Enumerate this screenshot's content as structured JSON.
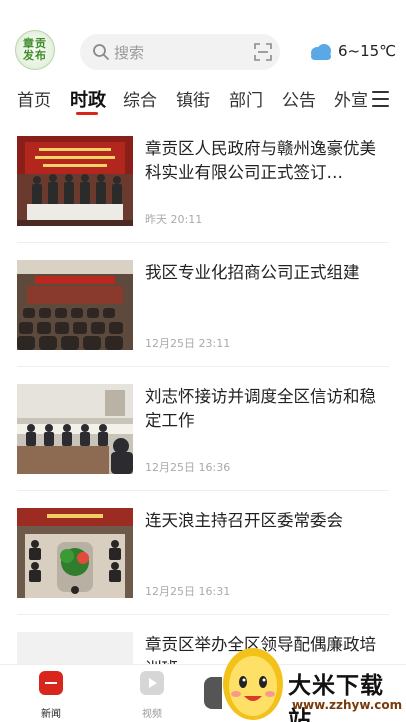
{
  "header": {
    "logo_text": [
      "章贡",
      "发布"
    ],
    "search": {
      "placeholder": "搜索"
    },
    "weather": {
      "temp": "6~15℃",
      "icon": "cloud-icon"
    }
  },
  "tabs": [
    {
      "label": "首页",
      "active": false
    },
    {
      "label": "时政",
      "active": true
    },
    {
      "label": "综合",
      "active": false
    },
    {
      "label": "镇街",
      "active": false
    },
    {
      "label": "部门",
      "active": false
    },
    {
      "label": "公告",
      "active": false
    },
    {
      "label": "外宣",
      "active": false
    }
  ],
  "news": [
    {
      "title": "章贡区人民政府与赣州逸豪优美科实业有限公司正式签订…",
      "time": "昨天 20:11",
      "thumb": "signing-ceremony-photo"
    },
    {
      "title": "我区专业化招商公司正式组建",
      "time": "12月25日 23:11",
      "thumb": "conference-hall-photo"
    },
    {
      "title": "刘志怀接访并调度全区信访和稳定工作",
      "time": "12月25日 16:36",
      "thumb": "meeting-room-photo"
    },
    {
      "title": "连天浪主持召开区委常委会",
      "time": "12月25日 16:31",
      "thumb": "committee-meeting-photo"
    },
    {
      "title": "章贡区举办全区领导配偶廉政培训班",
      "time": "",
      "thumb": "placeholder"
    }
  ],
  "bottom_nav": [
    {
      "label": "新闻",
      "active": true,
      "icon": "news-icon",
      "color": "#d8261d"
    },
    {
      "label": "视频",
      "active": false,
      "icon": "video-icon",
      "color": "#cccccc"
    }
  ],
  "watermark": {
    "text": "大米下载站",
    "url": "www.zzhyw.com"
  }
}
